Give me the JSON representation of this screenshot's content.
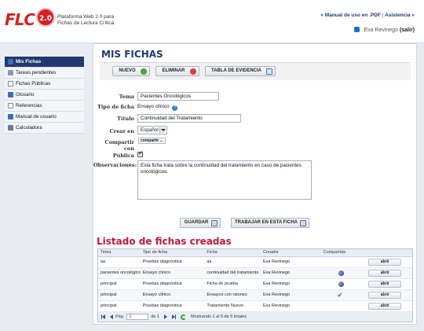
{
  "header": {
    "logo_text": "FLC",
    "logo_version": "2.0",
    "tagline": "Plataforma Web 2.0 para Fichas de Lectura Crítica",
    "links": {
      "manual": "« Manual de uso en .PDF",
      "separator": "|",
      "support": "Asistencia »"
    },
    "user_name": "Eva Revinego",
    "logout": "(salir)"
  },
  "sidebar": {
    "items": [
      {
        "label": "Mis Fichas",
        "icon": "folder-icon"
      },
      {
        "label": "Tareas pendientes",
        "icon": "tasks-icon"
      },
      {
        "label": "Fichas Públicas",
        "icon": "public-icon"
      },
      {
        "label": "Glosario",
        "icon": "glossary-icon"
      },
      {
        "label": "Referencias",
        "icon": "references-icon"
      },
      {
        "label": "Manual de usuario",
        "icon": "manual-icon"
      },
      {
        "label": "Calculadora",
        "icon": "calculator-icon"
      }
    ]
  },
  "main": {
    "title": "MIS FICHAS",
    "toolbar": {
      "new": "NUEVO",
      "delete": "ELIMINAR",
      "evidence": "TABLA DE EVIDENCIA"
    },
    "form": {
      "tema_label": "Tema",
      "tema_value": "Pacientes Oncológicos",
      "tipo_label": "Tipo de ficha",
      "tipo_value": "Ensayo clínico",
      "titulo_label": "Título",
      "titulo_value": "Continuidad del Tratamiento",
      "crear_label": "Crear en",
      "crear_value": "Español",
      "compartir_label": "Compartir con",
      "compartir_value": "compartir ...",
      "publica_label": "Pública",
      "obs_label": "Observaciones:",
      "obs_value": "Esta ficha trata sobre la continuidad del tratamiento en caso de pacientes oncológicos."
    },
    "actions": {
      "save": "GUARDAR",
      "work": "TRABAJAR EN ESTA FICHA"
    },
    "list_title": "Listado de fichas creadas",
    "grid": {
      "headers": [
        "Tema",
        "Tipo de ficha",
        "Ficha",
        "Creador",
        "Compartida",
        ""
      ],
      "open_label": "abrir",
      "rows": [
        {
          "tema": "aa",
          "tipo": "Pruebas diagnóstica",
          "ficha": "aa",
          "creador": "Eva Revinego",
          "shared": "none"
        },
        {
          "tema": "pacientes oncológicos",
          "tipo": "Ensayo clínico",
          "ficha": "continuidad del tratamiento",
          "creador": "Eva Revinego",
          "shared": "globe"
        },
        {
          "tema": "principal",
          "tipo": "Pruebas diagnóstica",
          "ficha": "Ficha de prueba",
          "creador": "Eva Revinego",
          "shared": "globe"
        },
        {
          "tema": "principal",
          "tipo": "Ensayo clínico",
          "ficha": "Ensayos con ratones",
          "creador": "Eva Revinego",
          "shared": "check"
        },
        {
          "tema": "principal",
          "tipo": "Pruebas diagnóstica",
          "ficha": "Tratamiento Nuevo",
          "creador": "Eva Revinego",
          "shared": "none"
        }
      ]
    },
    "pager": {
      "page_label": "Pág.",
      "page_value": "1",
      "of_label": "de 1",
      "status": "Mostrando 1 al 5 de 5 totales"
    }
  }
}
